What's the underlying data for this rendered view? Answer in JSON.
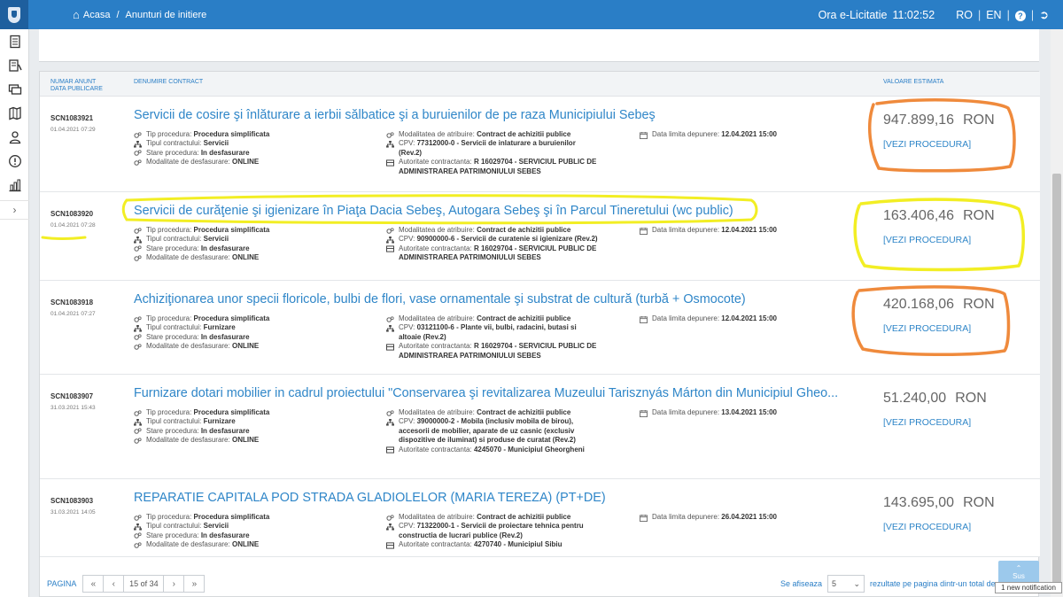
{
  "topbar": {
    "breadcrumb": [
      "Acasa",
      "Anunturi de initiere"
    ],
    "breadcrumb_sep": "/",
    "clock_label": "Ora e-Licitatie",
    "clock_time": "11:02:52",
    "lang_ro": "RO",
    "lang_en": "EN",
    "sep": "|",
    "help_glyph": "?"
  },
  "table": {
    "header_nr_1": "NUMAR ANUNT",
    "header_nr_2": "DATA PUBLICARE",
    "header_name": "DENUMIRE CONTRACT",
    "header_value": "VALOARE ESTIMATA"
  },
  "labels": {
    "tip": "Tip procedura:",
    "tipul": "Tipul contractului:",
    "stare": "Stare procedura:",
    "modalitate_desf": "Modalitate de desfasurare:",
    "modalitate_atr": "Modalitatea de atribuire:",
    "cpv": "CPV:",
    "autoritate": "Autoritate contractanta:",
    "data_limita": "Data limita depunere:",
    "vezi": "[VEZI PROCEDURA]",
    "currency": "RON"
  },
  "rows": [
    {
      "nr": "SCN1083921",
      "date": "01.04.2021 07:29",
      "title": "Servicii de cosire şi înlăturare a ierbii sălbatice şi a buruienilor de pe raza Municipiului Sebeş",
      "tip": "Procedura simplificata",
      "tipul": "Servicii",
      "stare": "In desfasurare",
      "modalitate": "ONLINE",
      "atribuire": "Contract de achizitii publice",
      "cpv": [
        "77312000-0 - Servicii de inlaturare a buruienilor",
        "(Rev.2)"
      ],
      "autoritate": [
        "R 16029704 - SERVICIUL PUBLIC DE",
        "ADMINISTRAREA PATRIMONIULUI SEBES"
      ],
      "deadline": "12.04.2021 15:00",
      "value": "947.899,16"
    },
    {
      "nr": "SCN1083920",
      "date": "01.04.2021 07:28",
      "title": "Servicii de curăţenie şi igienizare în Piaţa Dacia Sebeş, Autogara Sebeş şi în Parcul Tineretului (wc public)",
      "tip": "Procedura simplificata",
      "tipul": "Servicii",
      "stare": "In desfasurare",
      "modalitate": "ONLINE",
      "atribuire": "Contract de achizitii publice",
      "cpv": [
        "90900000-6 - Servicii de curatenie si igienizare (Rev.2)"
      ],
      "autoritate": [
        "R 16029704 - SERVICIUL PUBLIC DE",
        "ADMINISTRAREA PATRIMONIULUI SEBES"
      ],
      "deadline": "12.04.2021 15:00",
      "value": "163.406,46"
    },
    {
      "nr": "SCN1083918",
      "date": "01.04.2021 07:27",
      "title": "Achiziţionarea unor specii floricole, bulbi de flori, vase ornamentale şi substrat de cultură (turbă + Osmocote)",
      "tip": "Procedura simplificata",
      "tipul": "Furnizare",
      "stare": "In desfasurare",
      "modalitate": "ONLINE",
      "atribuire": "Contract de achizitii publice",
      "cpv": [
        "03121100-6 - Plante vii, bulbi, radacini, butasi si",
        "altoaie (Rev.2)"
      ],
      "autoritate": [
        "R 16029704 - SERVICIUL PUBLIC DE",
        "ADMINISTRAREA PATRIMONIULUI SEBES"
      ],
      "deadline": "12.04.2021 15:00",
      "value": "420.168,06"
    },
    {
      "nr": "SCN1083907",
      "date": "31.03.2021 15:43",
      "title": "Furnizare dotari mobilier in cadrul proiectului \"Conservarea şi revitalizarea Muzeului Tarisznyás Márton din Municipiul Gheo...",
      "tip": "Procedura simplificata",
      "tipul": "Furnizare",
      "stare": "In desfasurare",
      "modalitate": "ONLINE",
      "atribuire": "Contract de achizitii publice",
      "cpv": [
        "39000000-2 - Mobila (inclusiv mobila de birou),",
        "accesorii de mobilier, aparate de uz casnic (exclusiv",
        "dispozitive de iluminat) si produse de curatat (Rev.2)"
      ],
      "autoritate": [
        "4245070 - Municipiul Gheorgheni"
      ],
      "deadline": "13.04.2021 15:00",
      "value": "51.240,00"
    },
    {
      "nr": "SCN1083903",
      "date": "31.03.2021 14:05",
      "title": "REPARATIE CAPITALA POD STRADA GLADIOLELOR (MARIA TEREZA) (PT+DE)",
      "tip": "Procedura simplificata",
      "tipul": "Servicii",
      "stare": "In desfasurare",
      "modalitate": "ONLINE",
      "atribuire": "Contract de achizitii publice",
      "cpv": [
        "71322000-1 - Servicii de proiectare tehnica pentru",
        "constructia de lucrari publice (Rev.2)"
      ],
      "autoritate": [
        "4270740 - Municipiul Sibiu"
      ],
      "deadline": "26.04.2021 15:00",
      "value": "143.695,00"
    }
  ],
  "pagination": {
    "label": "PAGINA",
    "first": "«",
    "prev": "‹",
    "current": "15 of 34",
    "next": "›",
    "last": "»",
    "show_label": "Se afiseaza",
    "per_page": "5",
    "results_text": "rezultate pe pagina dintr-un total de 168"
  },
  "scroll_top": {
    "label": "Sus"
  },
  "notification": {
    "text": "1 new notification"
  },
  "annotations": {
    "orange": "#ef8a3c",
    "yellow": "#f2ee24"
  },
  "colors": {
    "topbar": "#2a7ec6",
    "link": "#2f86c8"
  }
}
